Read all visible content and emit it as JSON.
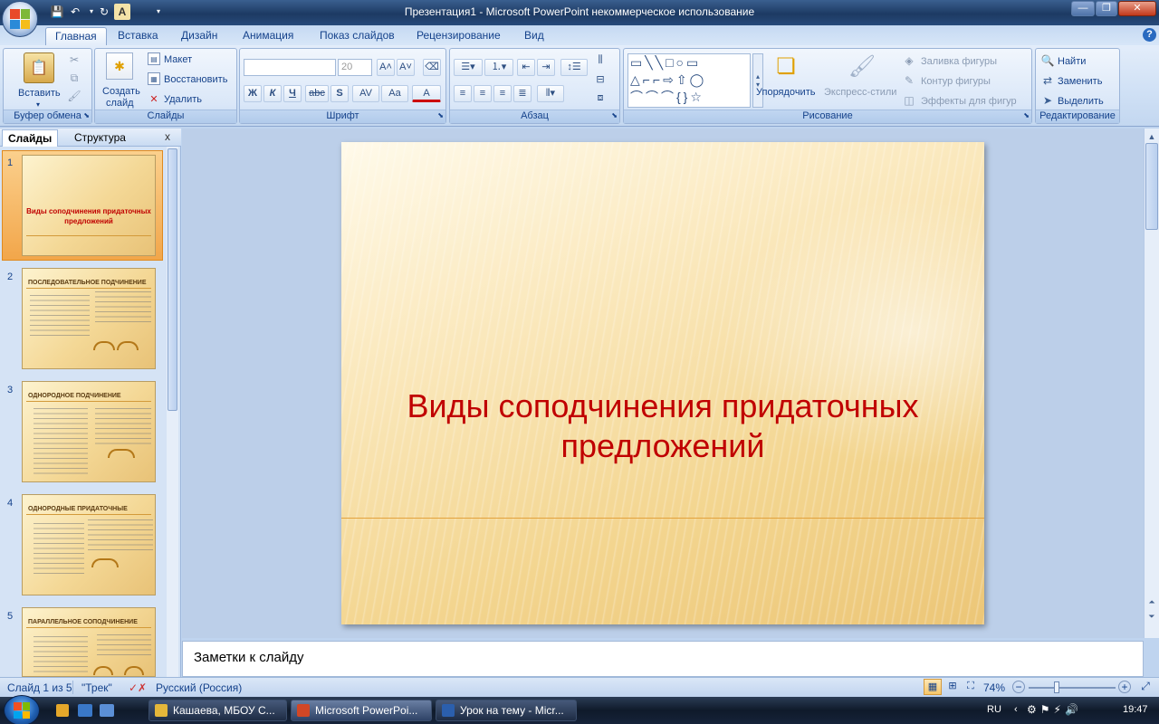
{
  "window": {
    "title": "Презентация1 - Microsoft PowerPoint некоммерческое использование",
    "min_label": "—",
    "max_label": "❐",
    "close_label": "✕"
  },
  "ribbon_tabs": [
    "Главная",
    "Вставка",
    "Дизайн",
    "Анимация",
    "Показ слайдов",
    "Рецензирование",
    "Вид"
  ],
  "ribbon": {
    "clipboard": {
      "label": "Буфер обмена",
      "paste": "Вставить"
    },
    "slides": {
      "label": "Слайды",
      "create": "Создать",
      "create2": "слайд",
      "layout": "Макет",
      "reset": "Восстановить",
      "delete": "Удалить"
    },
    "font": {
      "label": "Шрифт",
      "size": "20",
      "bold": "Ж",
      "italic": "К",
      "underline": "Ч",
      "strike": "abc",
      "shadow": "S",
      "spacing": "AV",
      "case": "Aa",
      "color": "A"
    },
    "paragraph": {
      "label": "Абзац"
    },
    "drawing": {
      "label": "Рисование",
      "arrange": "Упорядочить",
      "quick_styles": "Экспресс-стили",
      "fill": "Заливка фигуры",
      "outline": "Контур фигуры",
      "effects": "Эффекты для фигур"
    },
    "editing": {
      "label": "Редактирование",
      "find": "Найти",
      "replace": "Заменить",
      "select": "Выделить"
    }
  },
  "left_pane": {
    "tab_slides": "Слайды",
    "tab_outline": "Структура",
    "close": "x",
    "thumbnails": [
      {
        "num": "1",
        "title": "Виды соподчинения придаточных предложений"
      },
      {
        "num": "2",
        "title": "ПОСЛЕДОВАТЕЛЬНОЕ ПОДЧИНЕНИЕ"
      },
      {
        "num": "3",
        "title": "ОДНОРОДНОЕ ПОДЧИНЕНИЕ"
      },
      {
        "num": "4",
        "title": "ОДНОРОДНЫЕ ПРИДАТОЧНЫЕ"
      },
      {
        "num": "5",
        "title": "ПАРАЛЛЕЛЬНОЕ СОПОДЧИНЕНИЕ"
      }
    ]
  },
  "slide": {
    "title_line1": "Виды соподчинения придаточных",
    "title_line2": "предложений"
  },
  "notes": {
    "placeholder": "Заметки к слайду"
  },
  "status": {
    "slide_info": "Слайд 1 из 5",
    "theme": "\"Трек\"",
    "language": "Русский (Россия)",
    "zoom": "74%"
  },
  "taskbar": {
    "items": [
      "Кашаева, МБОУ С...",
      "Microsoft PowerPoi...",
      "Урок на тему - Micr..."
    ],
    "lang": "RU",
    "time": "19:47"
  }
}
